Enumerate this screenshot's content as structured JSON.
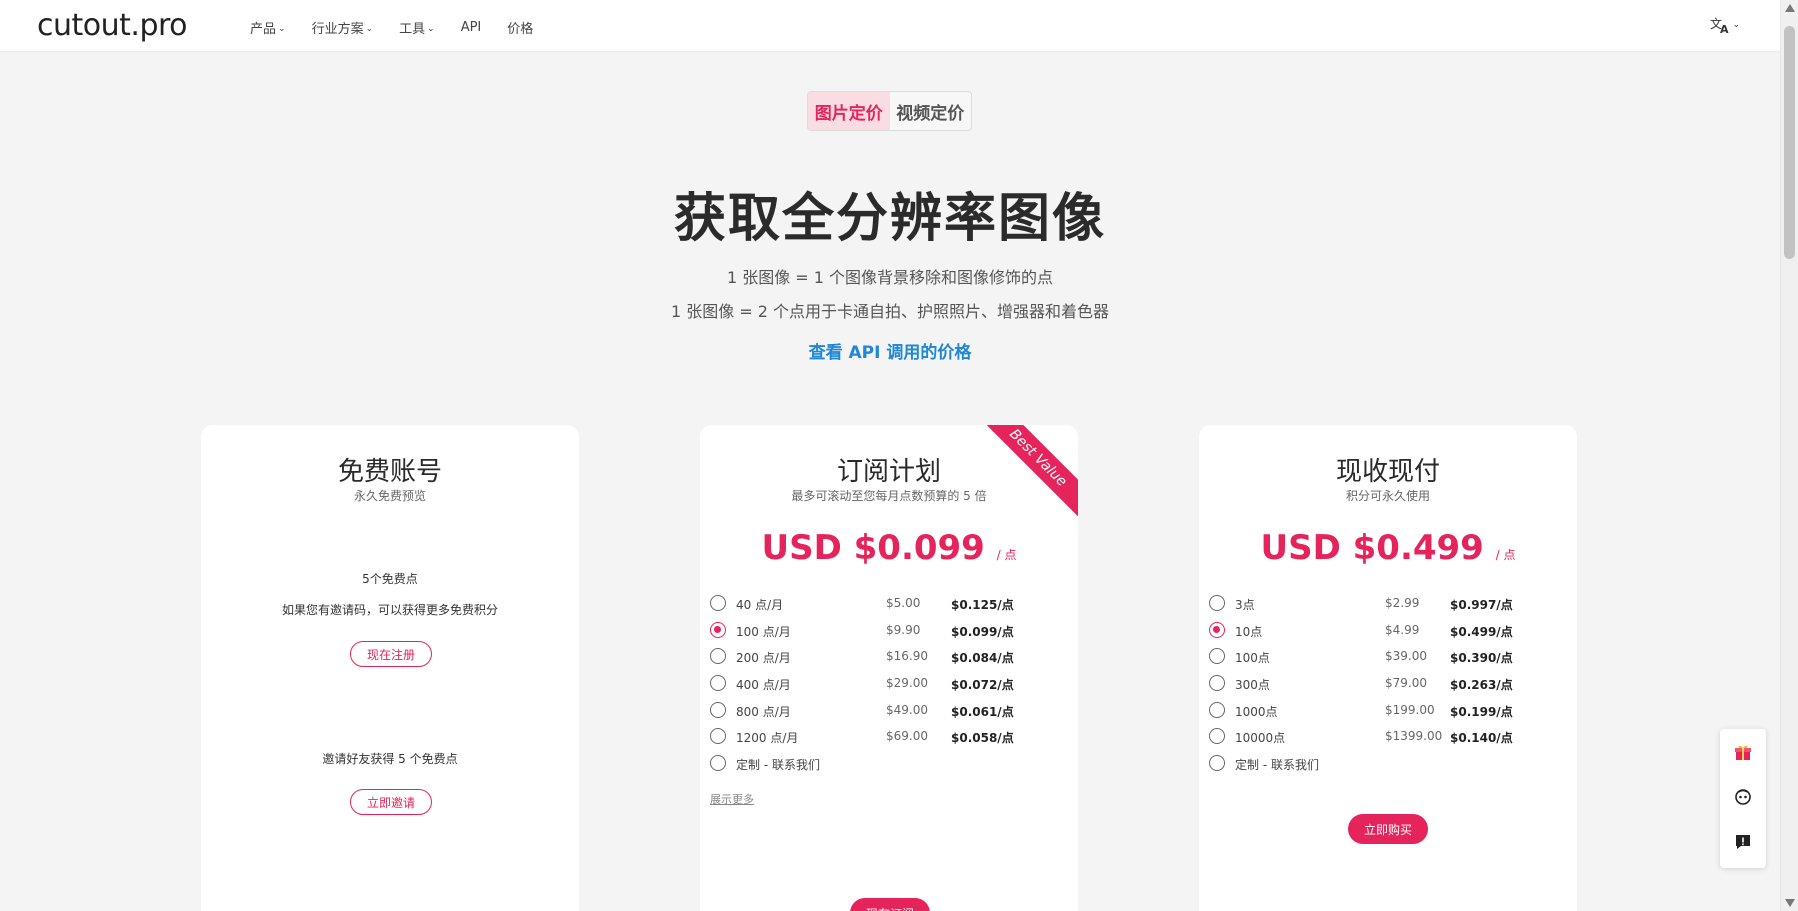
{
  "header": {
    "logo": "cutout.pro",
    "nav": [
      "产品",
      "行业方案",
      "工具",
      "API",
      "价格"
    ],
    "language_icon": "translate-icon"
  },
  "tabs": [
    {
      "label": "图片定价",
      "active": true
    },
    {
      "label": "视频定价",
      "active": false
    }
  ],
  "hero": {
    "title": "获取全分辨率图像",
    "line1": "1 张图像 = 1 个图像背景移除和图像修饰的点",
    "line2": "1 张图像 = 2 个点用于卡通自拍、护照照片、增强器和着色器",
    "api_link": "查看 API 调用的价格"
  },
  "free_plan": {
    "title": "免费账号",
    "subtitle": "永久免费预览",
    "points_text": "5个免费点",
    "invite_code_text": "如果您有邀请码，可以获得更多免费积分",
    "signup_button": "现在注册",
    "invite_text": "邀请好友获得 5 个免费点",
    "invite_button": "立即邀请"
  },
  "subscription_plan": {
    "title": "订阅计划",
    "subtitle": "最多可滚动至您每月点数预算的 5 倍",
    "ribbon": "Best Value",
    "price": "USD $0.099",
    "price_unit": "/ 点",
    "options": [
      {
        "label": "40 点/月",
        "price": "$5.00",
        "per_point": "$0.125/点",
        "checked": false
      },
      {
        "label": "100 点/月",
        "price": "$9.90",
        "per_point": "$0.099/点",
        "checked": true
      },
      {
        "label": "200 点/月",
        "price": "$16.90",
        "per_point": "$0.084/点",
        "checked": false
      },
      {
        "label": "400 点/月",
        "price": "$29.00",
        "per_point": "$0.072/点",
        "checked": false
      },
      {
        "label": "800 点/月",
        "price": "$49.00",
        "per_point": "$0.061/点",
        "checked": false
      },
      {
        "label": "1200 点/月",
        "price": "$69.00",
        "per_point": "$0.058/点",
        "checked": false
      },
      {
        "label": "定制 - 联系我们",
        "price": "",
        "per_point": "",
        "checked": false
      }
    ],
    "show_more": "展示更多",
    "button": "现在订阅"
  },
  "payg_plan": {
    "title": "现收现付",
    "subtitle": "积分可永久使用",
    "price": "USD $0.499",
    "price_unit": "/ 点",
    "options": [
      {
        "label": "3点",
        "price": "$2.99",
        "per_point": "$0.997/点",
        "checked": false
      },
      {
        "label": "10点",
        "price": "$4.99",
        "per_point": "$0.499/点",
        "checked": true
      },
      {
        "label": "100点",
        "price": "$39.00",
        "per_point": "$0.390/点",
        "checked": false
      },
      {
        "label": "300点",
        "price": "$79.00",
        "per_point": "$0.263/点",
        "checked": false
      },
      {
        "label": "1000点",
        "price": "$199.00",
        "per_point": "$0.199/点",
        "checked": false
      },
      {
        "label": "10000点",
        "price": "$1399.00",
        "per_point": "$0.140/点",
        "checked": false
      },
      {
        "label": "定制 - 联系我们",
        "price": "",
        "per_point": "",
        "checked": false
      }
    ],
    "button": "立即购买"
  },
  "floating_panel": [
    "gift-icon",
    "chat-robot-icon",
    "feedback-icon"
  ],
  "colors": {
    "accent": "#e5245c",
    "link": "#1e88d6",
    "background": "#f4f4f4"
  }
}
